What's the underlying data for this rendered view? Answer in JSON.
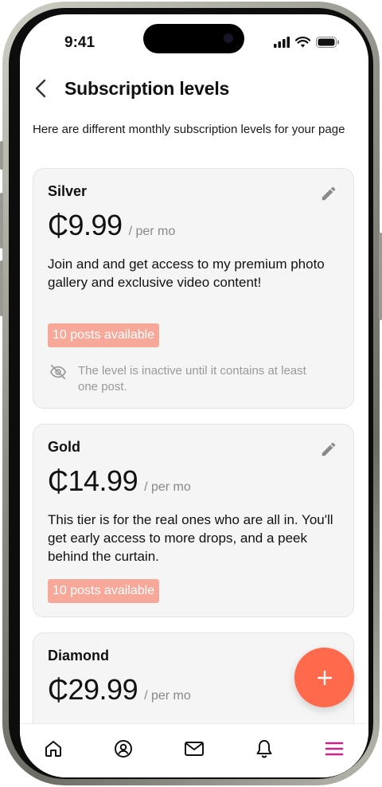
{
  "status": {
    "time": "9:41"
  },
  "header": {
    "title": "Subscription levels"
  },
  "intro": "Here are different monthly subscription levels for your page",
  "levels": [
    {
      "name": "Silver",
      "price": "₵9.99",
      "period": "/ per mo",
      "description": "Join and and get access to my premium photo gallery and exclusive video content!",
      "badge": "10 posts available",
      "note": "The level is inactive until it contains at least one post."
    },
    {
      "name": "Gold",
      "price": "₵14.99",
      "period": "/ per mo",
      "description": "This tier is for the real ones who are all in. You'll get early access to more drops, and a peek behind the curtain.",
      "badge": "10 posts available"
    },
    {
      "name": "Diamond",
      "price": "₵29.99",
      "period": "/ per mo"
    }
  ],
  "colors": {
    "accent": "#ff6a4d",
    "badge_bg": "#f8a898",
    "active_nav": "#c8218e"
  },
  "icons": {
    "back": "chevron-left-icon",
    "edit": "pencil-icon",
    "note": "eye-off-icon",
    "fab": "plus-icon"
  },
  "nav": [
    {
      "icon": "home-icon",
      "active": false
    },
    {
      "icon": "profile-icon",
      "active": false
    },
    {
      "icon": "mail-icon",
      "active": false
    },
    {
      "icon": "bell-icon",
      "active": false
    },
    {
      "icon": "menu-icon",
      "active": true
    }
  ]
}
